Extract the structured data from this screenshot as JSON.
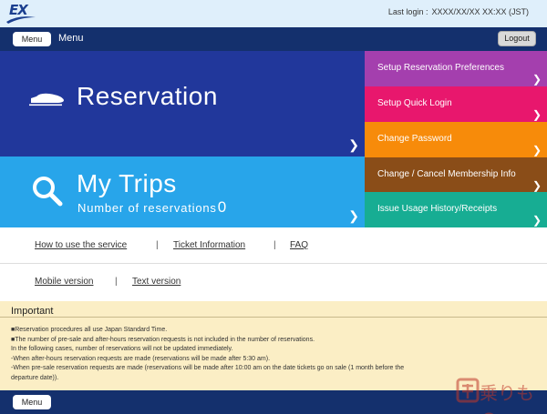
{
  "header": {
    "logo_text": "EX",
    "last_login_label": "Last login :",
    "last_login_value": "XXXX/XX/XX XX:XX (JST)"
  },
  "navbar": {
    "menu_button": "Menu",
    "menu_label": "Menu",
    "logout_button": "Logout"
  },
  "tiles": {
    "reservation": {
      "title": "Reservation",
      "color": "#21379b"
    },
    "trips": {
      "title": "My Trips",
      "count_label": "Number of reservations",
      "count_value": "0",
      "color": "#28a5ea"
    }
  },
  "side_menu": [
    {
      "label": "Setup Reservation Preferences",
      "color": "#a43fae"
    },
    {
      "label": "Setup Quick Login",
      "color": "#e8176d"
    },
    {
      "label": "Change Password",
      "color": "#f78b0a"
    },
    {
      "label": "Change / Cancel Membership Info",
      "color": "#8a4d18"
    },
    {
      "label": "Issue Usage History/Receipts",
      "color": "#17ad93"
    }
  ],
  "links": {
    "how_to": "How to use the service",
    "ticket_info": "Ticket Information",
    "faq": "FAQ",
    "mobile": "Mobile version",
    "text": "Text version",
    "separator": "|"
  },
  "important": {
    "title": "Important",
    "lines": [
      "■Reservation procedures all use Japan Standard Time.",
      "■The number of pre-sale and after-hours reservation requests is not included in the number of reservations.",
      "In the following cases, number of reservations will not be updated immediately.",
      "-When after-hours reservation requests are made (reservations will be made after 5:30 am).",
      "-When pre-sale reservation requests are made (reservations will be made after 10:00 am on the date tickets go on sale (1 month before the",
      "departure date))."
    ],
    "background": "#fbeec5"
  },
  "footer": {
    "menu_button": "Menu"
  },
  "watermark": {
    "text": "乗りもの"
  },
  "icons": [
    "train-icon",
    "search-icon",
    "chevron-right-icon"
  ]
}
